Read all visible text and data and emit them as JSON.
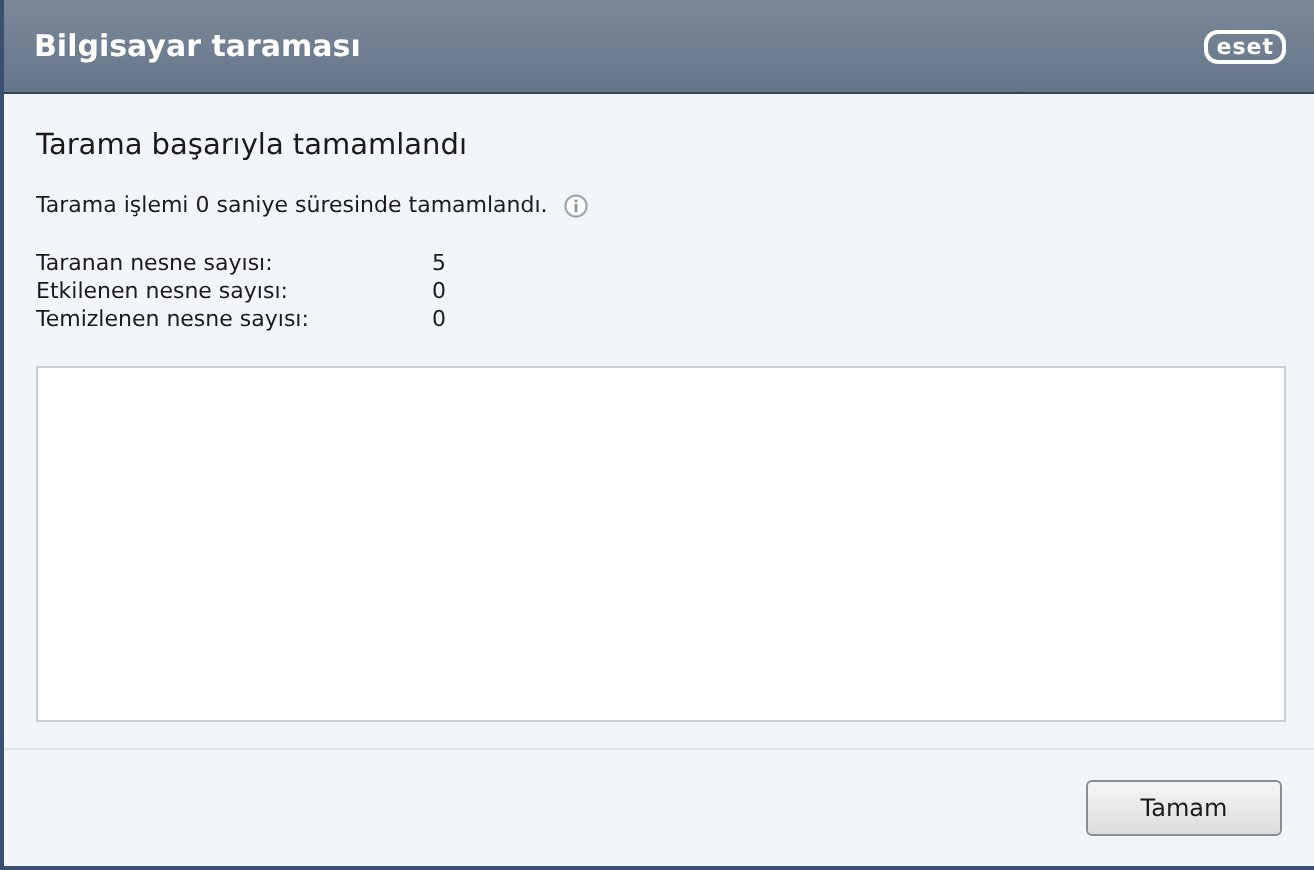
{
  "window": {
    "title": "Bilgisayar taraması",
    "logo": "eset"
  },
  "heading": "Tarama başarıyla tamamlandı",
  "summary": "Tarama işlemi 0 saniye süresinde tamamlandı.",
  "stats": [
    {
      "label": "Taranan nesne sayısı:",
      "value": "5"
    },
    {
      "label": "Etkilenen nesne sayısı:",
      "value": "0"
    },
    {
      "label": "Temizlenen nesne sayısı:",
      "value": "0"
    }
  ],
  "buttons": [
    "Tamam"
  ]
}
